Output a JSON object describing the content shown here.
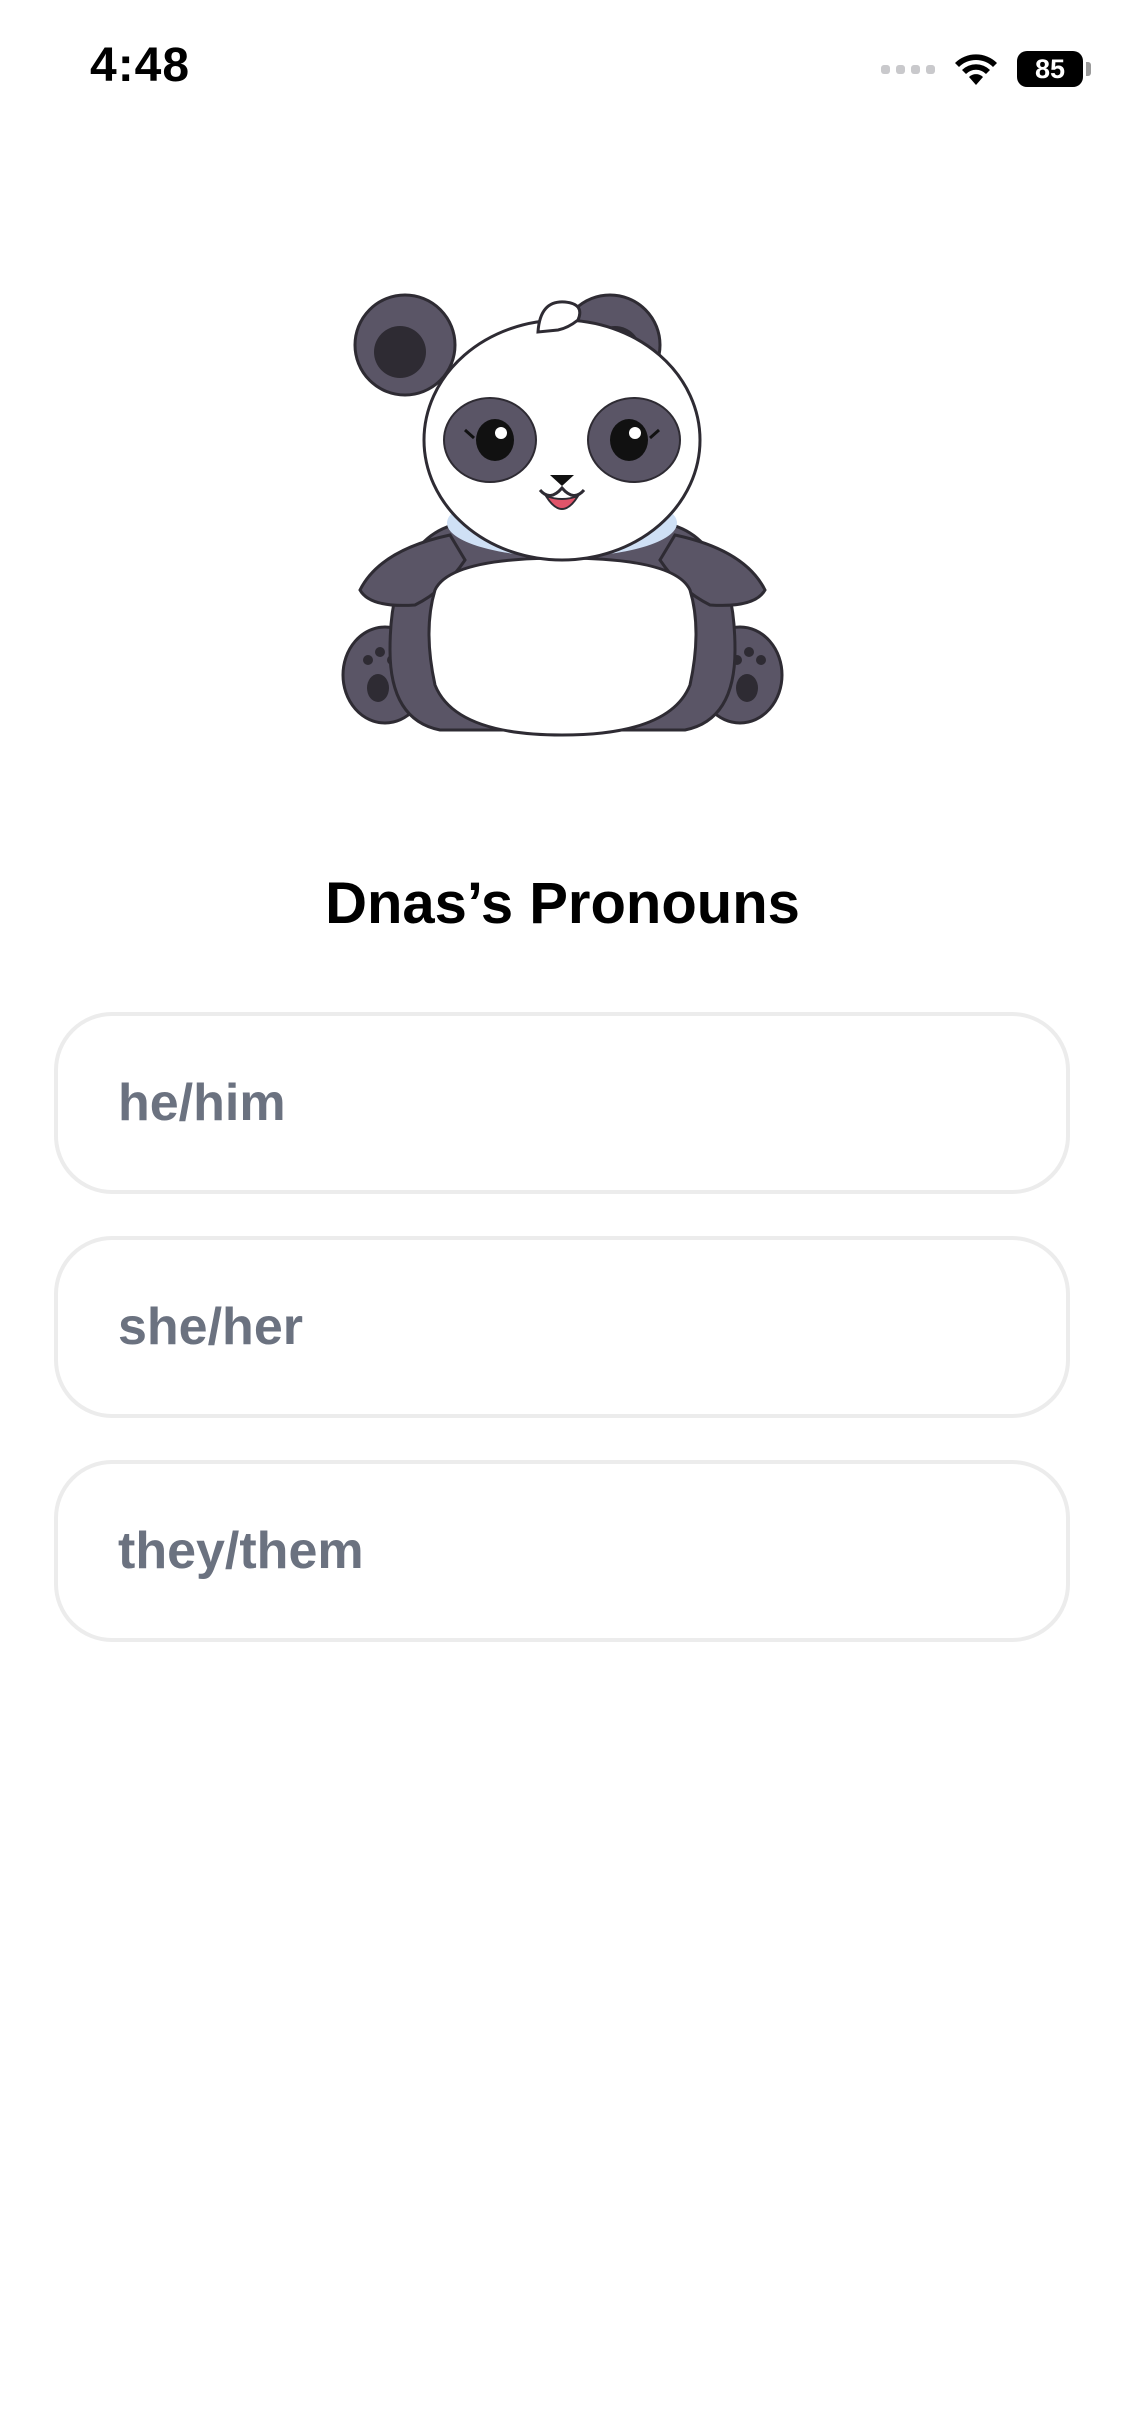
{
  "status_bar": {
    "time": "4:48",
    "battery_level": "85",
    "icons": [
      "cellular-signal-icon",
      "wifi-icon",
      "battery-icon"
    ]
  },
  "mascot": {
    "icon": "panda-mascot-icon"
  },
  "title": "Dnas’s Pronouns",
  "pronoun_options": [
    {
      "label": "he/him"
    },
    {
      "label": "she/her"
    },
    {
      "label": "they/them"
    }
  ],
  "colors": {
    "option_border": "#ececec",
    "option_text": "#6b7280",
    "panda_dark": "#5a5566",
    "panda_darker": "#2e2b33",
    "collar": "#cfe0f5"
  }
}
